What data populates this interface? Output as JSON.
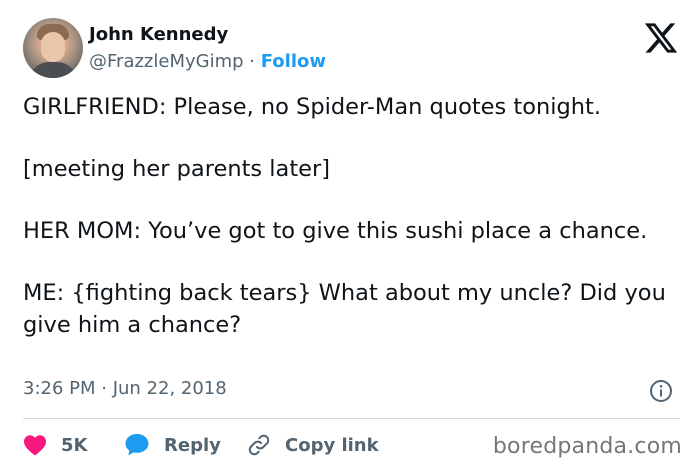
{
  "author": {
    "name": "John Kennedy",
    "handle": "@FrazzleMyGimp",
    "separator": " · ",
    "follow_label": "Follow"
  },
  "tweet": {
    "paragraphs": [
      "GIRLFRIEND: Please, no Spider-Man quotes tonight.",
      "[meeting her parents later]",
      "HER MOM: You’ve got to give this sushi place a chance.",
      "ME: {fighting back tears} What about my uncle? Did you give him a chance?"
    ],
    "timestamp": "3:26 PM · Jun 22, 2018"
  },
  "actions": {
    "likes_count": "5K",
    "reply_label": "Reply",
    "copy_link_label": "Copy link"
  },
  "watermark": "boredpanda.com",
  "colors": {
    "accent": "#1d9bf0",
    "like": "#f91880",
    "text": "#0f1419",
    "muted": "#536471"
  },
  "icons": [
    "x-logo-icon",
    "info-icon",
    "heart-icon",
    "reply-bubble-icon",
    "link-icon"
  ]
}
